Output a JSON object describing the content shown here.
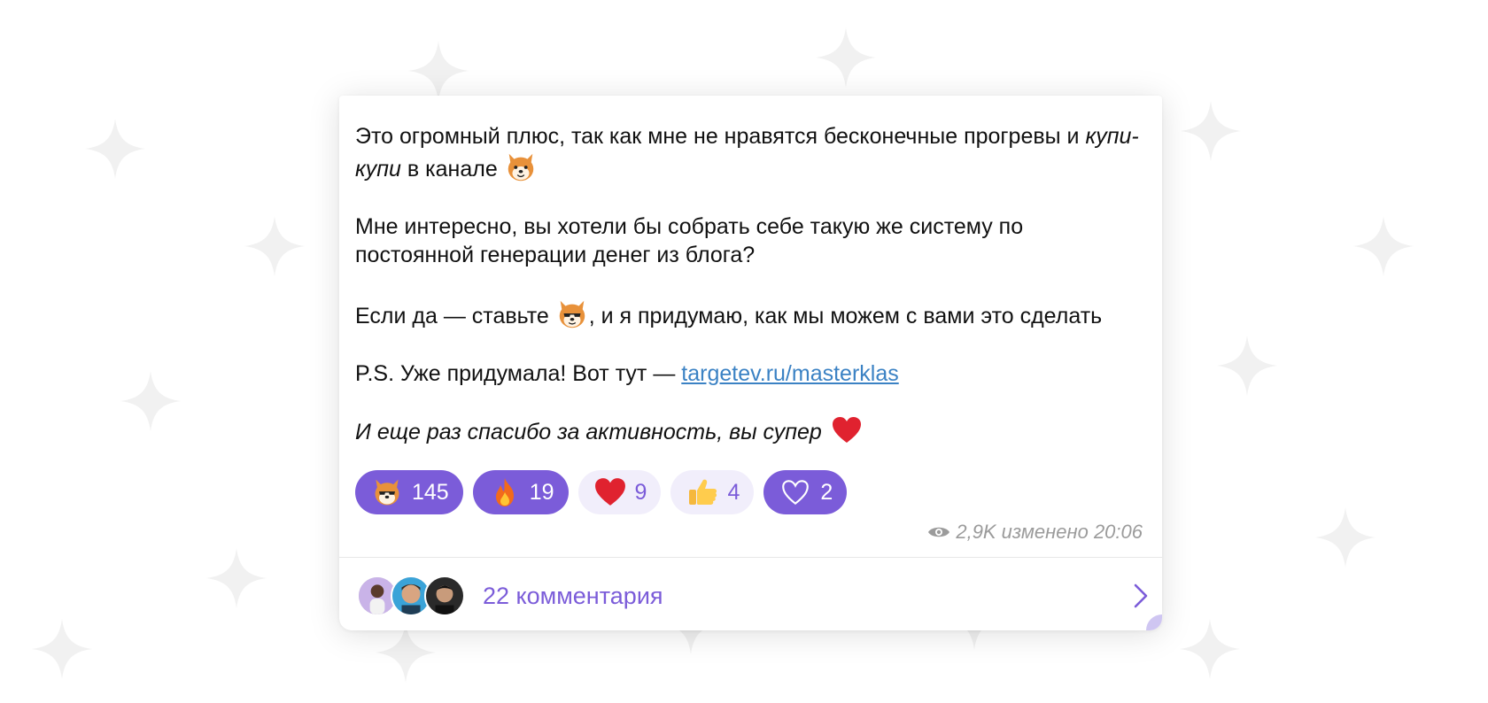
{
  "post": {
    "paragraph1_a": "Это огромный плюс, так как мне не нравятся бесконечные прогревы и ",
    "paragraph1_italic": "купи-купи",
    "paragraph1_b": " в канале",
    "paragraph2": "Мне интересно, вы хотели бы собрать себе такую же систему по постоянной генерации денег из блога?",
    "paragraph3_a": "Если да — ставьте ",
    "paragraph3_b": ", и я придумаю, как мы можем с вами это сделать",
    "paragraph4_a": "P.S. Уже придумала! Вот тут — ",
    "paragraph4_link": "targetev.ru/masterklas",
    "paragraph5": "И еще раз спасибо за активность, вы супер"
  },
  "reactions": [
    {
      "icon": "shiba-dog-emoji",
      "count": "145",
      "active": true
    },
    {
      "icon": "fire-emoji",
      "count": "19",
      "active": true
    },
    {
      "icon": "red-heart-emoji",
      "count": "9",
      "active": false
    },
    {
      "icon": "thumbs-up-emoji",
      "count": "4",
      "active": false
    },
    {
      "icon": "outline-heart-icon",
      "count": "2",
      "active": true
    }
  ],
  "meta": {
    "views": "2,9K",
    "edited_time": "изменено 20:06"
  },
  "comments": {
    "label": "22 комментария"
  },
  "colors": {
    "accent": "#7b5cd9",
    "reaction_bg_passive": "#f1eefb",
    "link": "#3b82c4",
    "meta_text": "#9b9b9b"
  }
}
